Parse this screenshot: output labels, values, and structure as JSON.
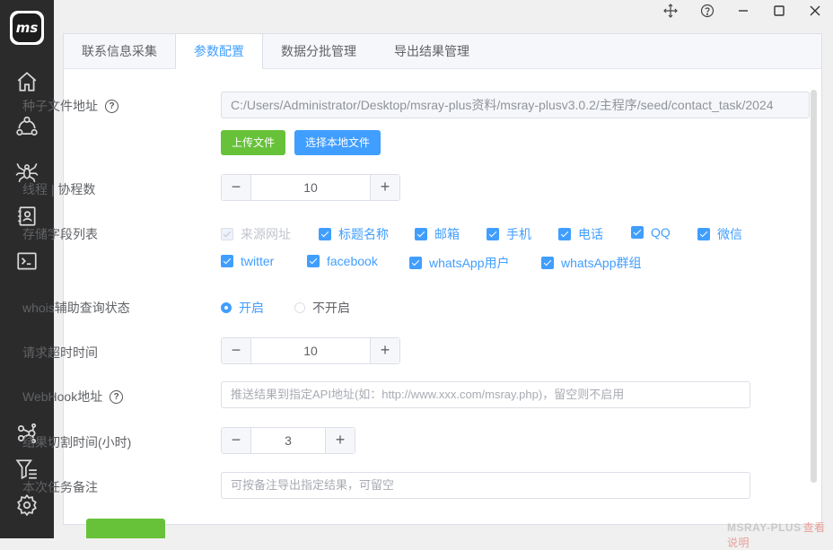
{
  "app": {
    "logo_text": "ms"
  },
  "sidebar": {
    "items": [
      {
        "icon": "home-icon"
      },
      {
        "icon": "share-network-icon"
      },
      {
        "icon": "spider-icon"
      },
      {
        "icon": "contacts-icon"
      },
      {
        "icon": "terminal-icon"
      },
      {
        "icon": "nodes-icon"
      },
      {
        "icon": "filter-list-icon"
      },
      {
        "icon": "gear-icon"
      }
    ]
  },
  "tabs": [
    {
      "label": "联系信息采集",
      "active": false
    },
    {
      "label": "参数配置",
      "active": true
    },
    {
      "label": "数据分批管理",
      "active": false
    },
    {
      "label": "导出结果管理",
      "active": false
    }
  ],
  "form": {
    "seed_file": {
      "label": "种子文件地址",
      "value": "C:/Users/Administrator/Desktop/msray-plus资料/msray-plusv3.0.2/主程序/seed/contact_task/2024",
      "upload_label": "上传文件",
      "choose_label": "选择本地文件"
    },
    "threads": {
      "label": "线程 | 协程数",
      "value": "10"
    },
    "fields": {
      "label": "存储字段列表",
      "options": [
        {
          "label": "来源网址",
          "checked": true,
          "disabled": true
        },
        {
          "label": "标题名称",
          "checked": true
        },
        {
          "label": "邮箱",
          "checked": true
        },
        {
          "label": "手机",
          "checked": true
        },
        {
          "label": "电话",
          "checked": true
        },
        {
          "label": "QQ",
          "checked": true
        },
        {
          "label": "微信",
          "checked": true
        },
        {
          "label": "twitter",
          "checked": true
        },
        {
          "label": "facebook",
          "checked": true
        },
        {
          "label": "whatsApp用户",
          "checked": true
        },
        {
          "label": "whatsApp群组",
          "checked": true
        }
      ]
    },
    "whois": {
      "label": "whois辅助查询状态",
      "on_label": "开启",
      "off_label": "不开启",
      "selected": "on"
    },
    "timeout": {
      "label": "请求超时时间",
      "value": "10"
    },
    "webhook": {
      "label": "WebHook地址",
      "placeholder": "推送结果到指定API地址(如：http://www.xxx.com/msray.php)，留空则不启用"
    },
    "split_time": {
      "label": "结果切割时间(小时)",
      "value": "3"
    },
    "note": {
      "label": "本次任务备注",
      "placeholder": "可按备注导出指定结果，可留空"
    }
  },
  "stepper": {
    "minus": "−",
    "plus": "+"
  },
  "help_glyph": "?",
  "watermark": {
    "brand": "MSRAY-PLUS",
    "link": "查看说明"
  },
  "colors": {
    "primary": "#409eff",
    "success": "#67c23a",
    "sidebar": "#2b2b2b"
  }
}
